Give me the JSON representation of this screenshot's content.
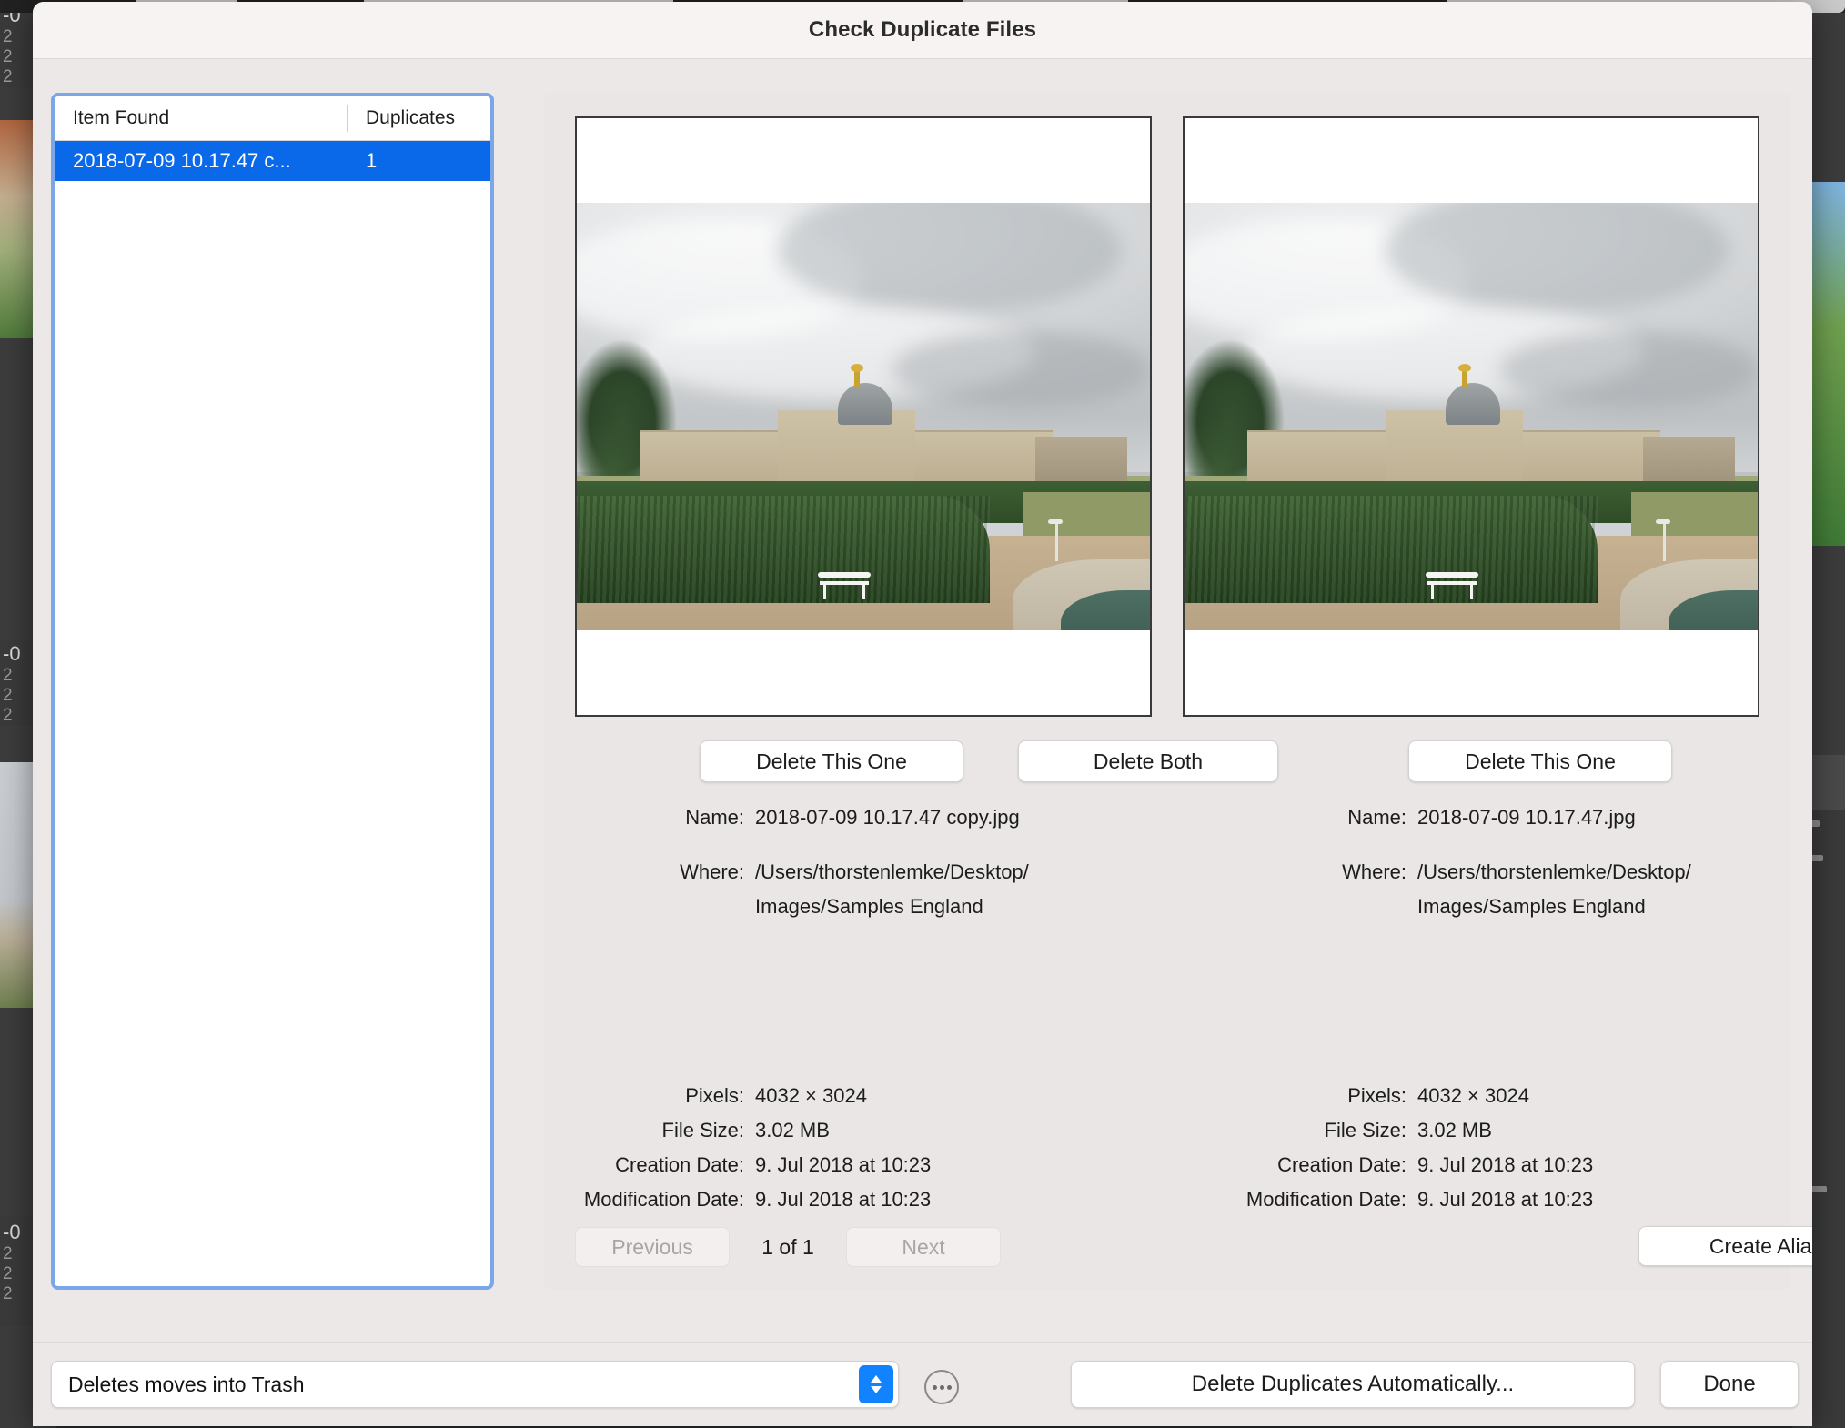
{
  "window": {
    "title": "Check Duplicate Files"
  },
  "list": {
    "columns": {
      "name": "Item Found",
      "duplicates": "Duplicates"
    },
    "rows": [
      {
        "name": "2018-07-09 10.17.47 c...",
        "duplicates": "1"
      }
    ]
  },
  "detail": {
    "buttons": {
      "delete_left": "Delete This One",
      "delete_both": "Delete Both",
      "delete_right": "Delete This One",
      "create_aliases": "Create Aliases On Desktop",
      "previous": "Previous",
      "next": "Next"
    },
    "page_indicator": "1 of 1",
    "labels": {
      "name": "Name:",
      "where": "Where:",
      "pixels": "Pixels:",
      "file_size": "File Size:",
      "creation_date": "Creation Date:",
      "modification_date": "Modification Date:"
    },
    "left_file": {
      "name": "2018-07-09 10.17.47 copy.jpg",
      "where": "/Users/thorstenlemke/Desktop/\nImages/Samples England",
      "pixels": "4032 × 3024",
      "file_size": "3.02 MB",
      "creation_date": "9. Jul 2018 at 10:23",
      "modification_date": "9. Jul 2018 at 10:23"
    },
    "right_file": {
      "name": "2018-07-09 10.17.47.jpg",
      "where": "/Users/thorstenlemke/Desktop/\nImages/Samples England",
      "pixels": "4032 × 3024",
      "file_size": "3.02 MB",
      "creation_date": "9. Jul 2018 at 10:23",
      "modification_date": "9. Jul 2018 at 10:23"
    }
  },
  "footer": {
    "delete_mode": "Deletes moves into Trash",
    "delete_automatically": "Delete Duplicates Automatically...",
    "done": "Done"
  },
  "background": {
    "left_strips": [
      {
        "title": "-0",
        "lines": "2\n2\n2"
      },
      {
        "title": "-0",
        "lines": "2\n2\n2"
      },
      {
        "title": "-0",
        "lines": "2\n2\n2"
      }
    ]
  },
  "colors": {
    "selection_blue": "#0a69e8",
    "focus_ring_blue": "#7ba7e8",
    "stepper_blue": "#1183fe",
    "window_bg": "#ebe8e7",
    "titlebar_bg": "#f7f3f2"
  }
}
